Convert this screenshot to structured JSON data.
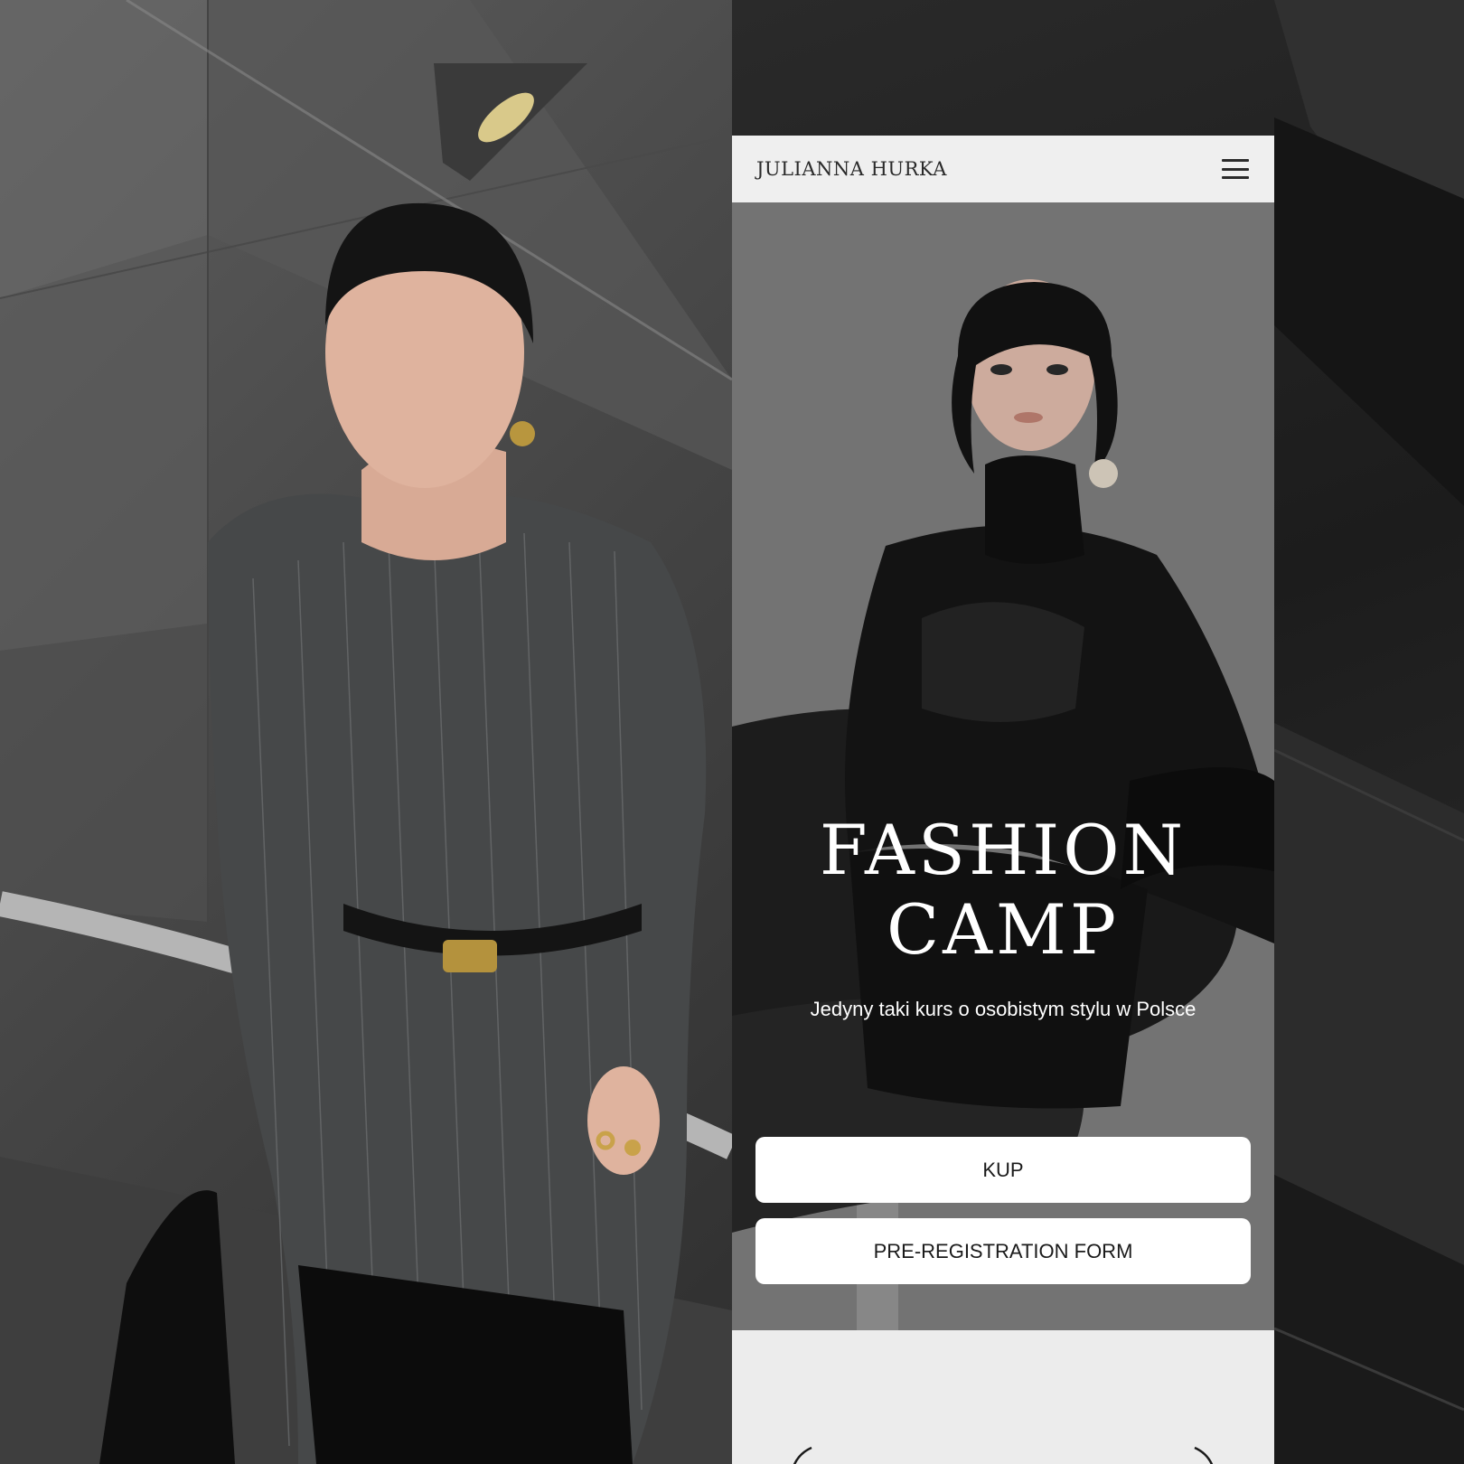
{
  "nav": {
    "logo": "JULIANNA HURKA",
    "menu_icon": "hamburger-menu-icon"
  },
  "hero": {
    "title_line1": "FASHION",
    "title_line2": "CAMP",
    "subtitle": "Jedyny taki kurs o osobistym stylu w Polsce",
    "buy_label": "KUP",
    "prereg_label": "PRE-REGISTRATION FORM"
  },
  "carousel": {
    "prev_icon": "arrow-left-icon",
    "next_icon": "arrow-right-icon"
  },
  "colors": {
    "nav_bg": "#efefef",
    "hero_overlay": "#787878",
    "button_bg": "#ffffff",
    "text_dark": "#1a1a1a",
    "page_bg": "#ececec"
  }
}
